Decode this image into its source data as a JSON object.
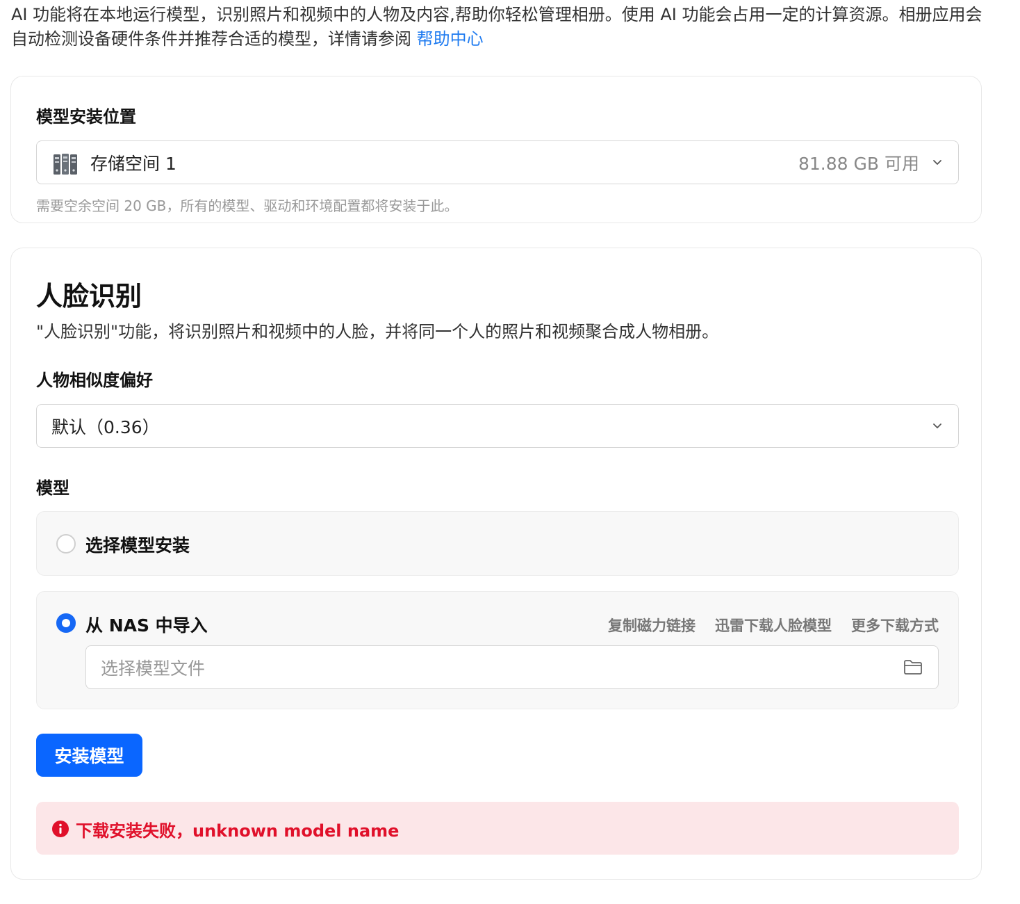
{
  "intro": {
    "text": "AI 功能将在本地运行模型，识别照片和视频中的人物及内容,帮助你轻松管理相册。使用 AI 功能会占用一定的计算资源。相册应用会自动检测设备硬件条件并推荐合适的模型，详情请参阅 ",
    "link_label": "帮助中心"
  },
  "install_location": {
    "label": "模型安装位置",
    "storage_name": "存储空间 1",
    "storage_free": "81.88 GB 可用",
    "hint": "需要空余空间 20 GB，所有的模型、驱动和环境配置都将安装于此。"
  },
  "face_recognition": {
    "title": "人脸识别",
    "description": "\"人脸识别\"功能，将识别照片和视频中的人脸，并将同一个人的照片和视频聚合成人物相册。",
    "similarity_label": "人物相似度偏好",
    "similarity_value": "默认（0.36）",
    "model_label": "模型",
    "option_select": {
      "label": "选择模型安装",
      "selected": false
    },
    "option_import": {
      "label": "从 NAS 中导入",
      "selected": true,
      "links": [
        "复制磁力链接",
        "迅雷下载人脸模型",
        "更多下载方式"
      ],
      "file_placeholder": "选择模型文件"
    },
    "install_button": "安装模型",
    "error_message": "下载安装失败，unknown model name"
  },
  "colors": {
    "accent": "#0a66ff",
    "link": "#1f7bf0",
    "error": "#e0102a",
    "error_bg": "#fce6e8"
  },
  "icons": [
    "disk-icon",
    "chevron-down-icon",
    "folder-icon",
    "error-icon"
  ]
}
